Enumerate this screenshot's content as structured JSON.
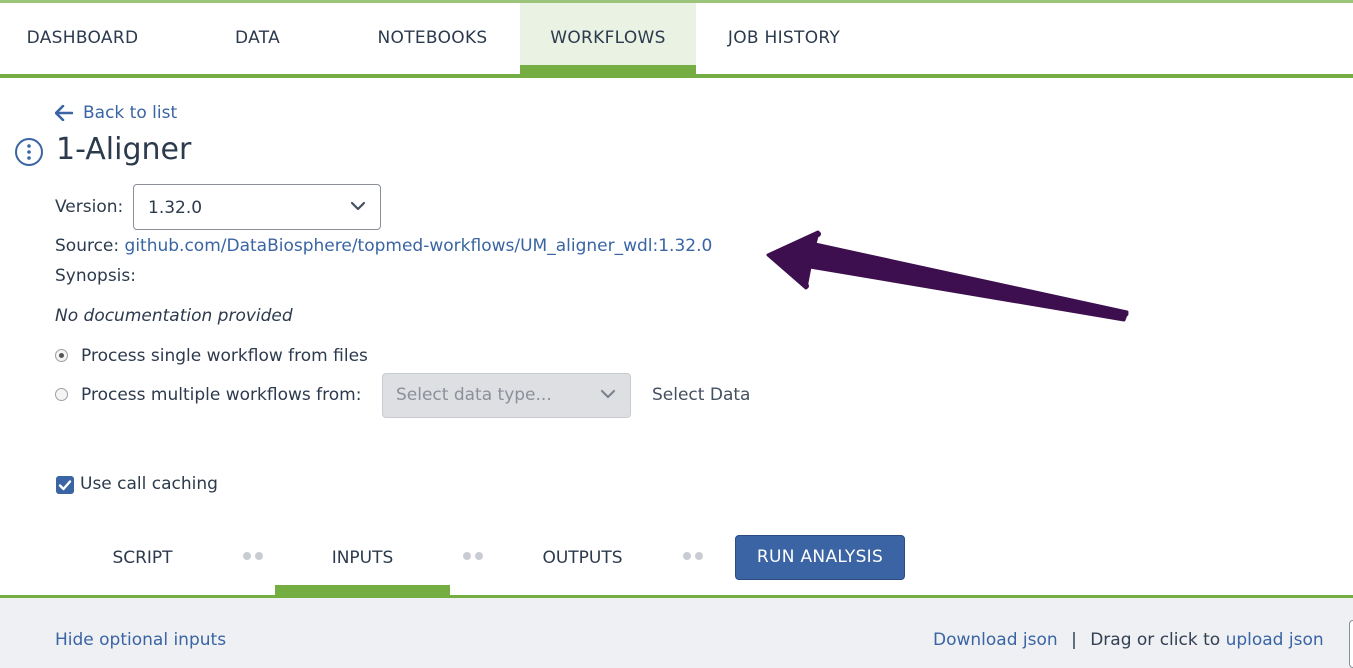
{
  "nav": {
    "tabs": [
      {
        "label": "DASHBOARD"
      },
      {
        "label": "DATA"
      },
      {
        "label": "NOTEBOOKS"
      },
      {
        "label": "WORKFLOWS",
        "active": true
      },
      {
        "label": "JOB HISTORY"
      }
    ]
  },
  "back_link": "Back to list",
  "workflow": {
    "title": "1-Aligner",
    "version_label": "Version:",
    "version_value": "1.32.0",
    "source_label": "Source:",
    "source_link": "github.com/DataBiosphere/topmed-workflows/UM_aligner_wdl:1.32.0",
    "synopsis_label": "Synopsis:",
    "documentation": "No documentation provided"
  },
  "process": {
    "single_label": "Process single workflow from files",
    "single_selected": true,
    "multiple_label": "Process multiple workflows from:",
    "data_type_placeholder": "Select data type...",
    "select_data_label": "Select Data"
  },
  "call_caching": {
    "label": "Use call caching",
    "checked": true
  },
  "steps": {
    "script": "SCRIPT",
    "inputs": "INPUTS",
    "outputs": "OUTPUTS",
    "active": "INPUTS",
    "run_button": "RUN ANALYSIS"
  },
  "bottom": {
    "hide_optional": "Hide optional inputs",
    "download_json": "Download json",
    "separator": "|",
    "drag_text": "Drag or click to",
    "upload_json": "upload json"
  },
  "colors": {
    "accent_green": "#74ae43",
    "link_blue": "#3a64a3",
    "annotation_arrow": "#3d0f4f"
  },
  "annotation": {
    "arrow_icon": "hand-drawn-arrow-icon"
  }
}
